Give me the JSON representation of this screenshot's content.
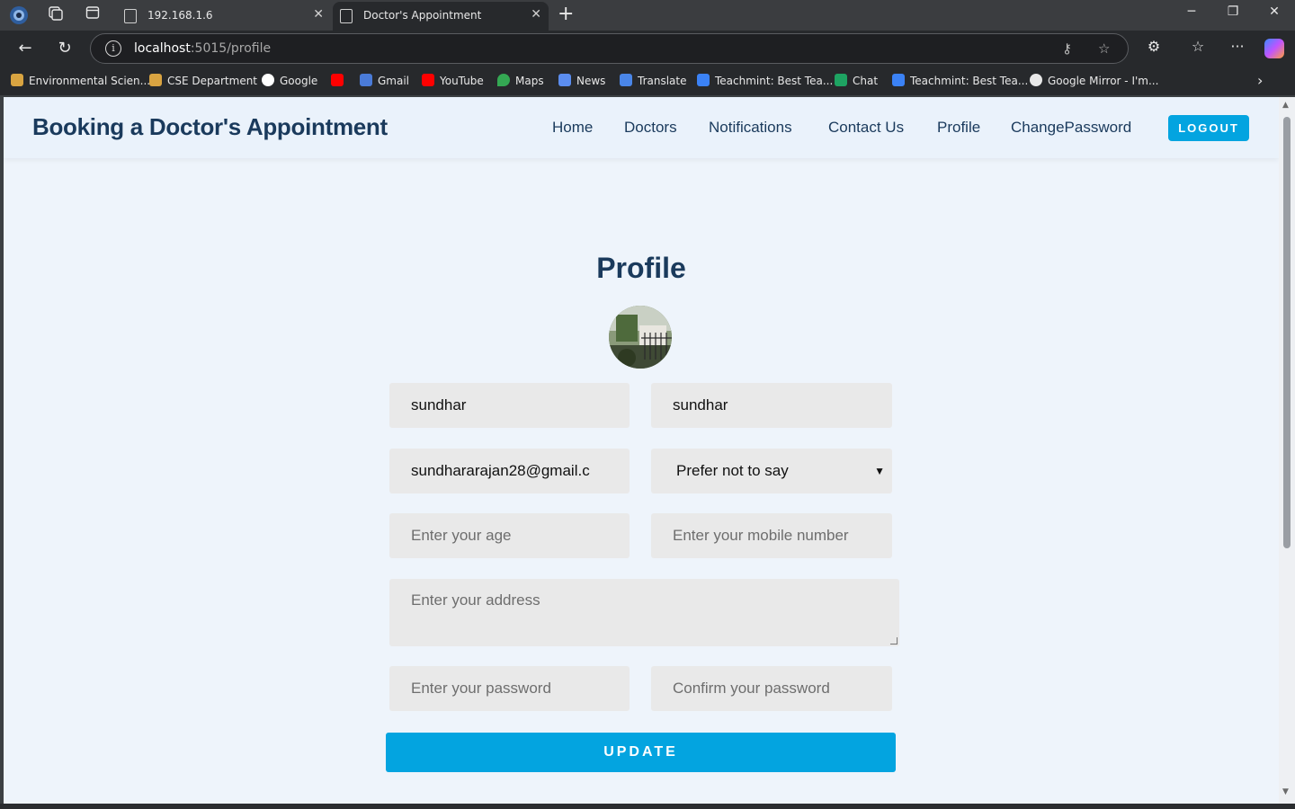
{
  "browser": {
    "tabs": [
      {
        "title": "192.168.1.6"
      },
      {
        "title": "Doctor's Appointment"
      }
    ],
    "address": {
      "host": "localhost",
      "path": ":5015/profile"
    },
    "bookmarks": [
      {
        "label": "Environmental Scien...",
        "color": "#d9a441"
      },
      {
        "label": "CSE Department",
        "color": "#d9a441"
      },
      {
        "label": "Google",
        "color": "#ffffff"
      },
      {
        "label": "",
        "color": "#ff0000"
      },
      {
        "label": "Gmail",
        "color": "#4a7bd8"
      },
      {
        "label": "YouTube",
        "color": "#ff0000"
      },
      {
        "label": "Maps",
        "color": "#34a853"
      },
      {
        "label": "News",
        "color": "#5b8def"
      },
      {
        "label": "Translate",
        "color": "#4a86e8"
      },
      {
        "label": "Teachmint: Best Tea...",
        "color": "#3b82f6"
      },
      {
        "label": "Chat",
        "color": "#1ea362"
      },
      {
        "label": "Teachmint: Best Tea...",
        "color": "#3b82f6"
      },
      {
        "label": "Google Mirror - I'm...",
        "color": "#e8e8e8"
      }
    ]
  },
  "site": {
    "brand": "Booking a Doctor's Appointment",
    "nav": [
      "Home",
      "Doctors",
      "Notifications",
      "Contact Us",
      "Profile",
      "ChangePassword"
    ],
    "logout_label": "LOGOUT",
    "accent": "#03a4e0",
    "text_color": "#1a3a5c"
  },
  "profile": {
    "title": "Profile",
    "first_name": "sundhar",
    "last_name": "sundhar",
    "email": "sundhararajan28@gmail.c",
    "gender": "Prefer not to say",
    "age_placeholder": "Enter your age",
    "mobile_placeholder": "Enter your mobile number",
    "address_placeholder": "Enter your address",
    "password_placeholder": "Enter your password",
    "confirm_placeholder": "Confirm your password",
    "update_label": "UPDATE"
  }
}
